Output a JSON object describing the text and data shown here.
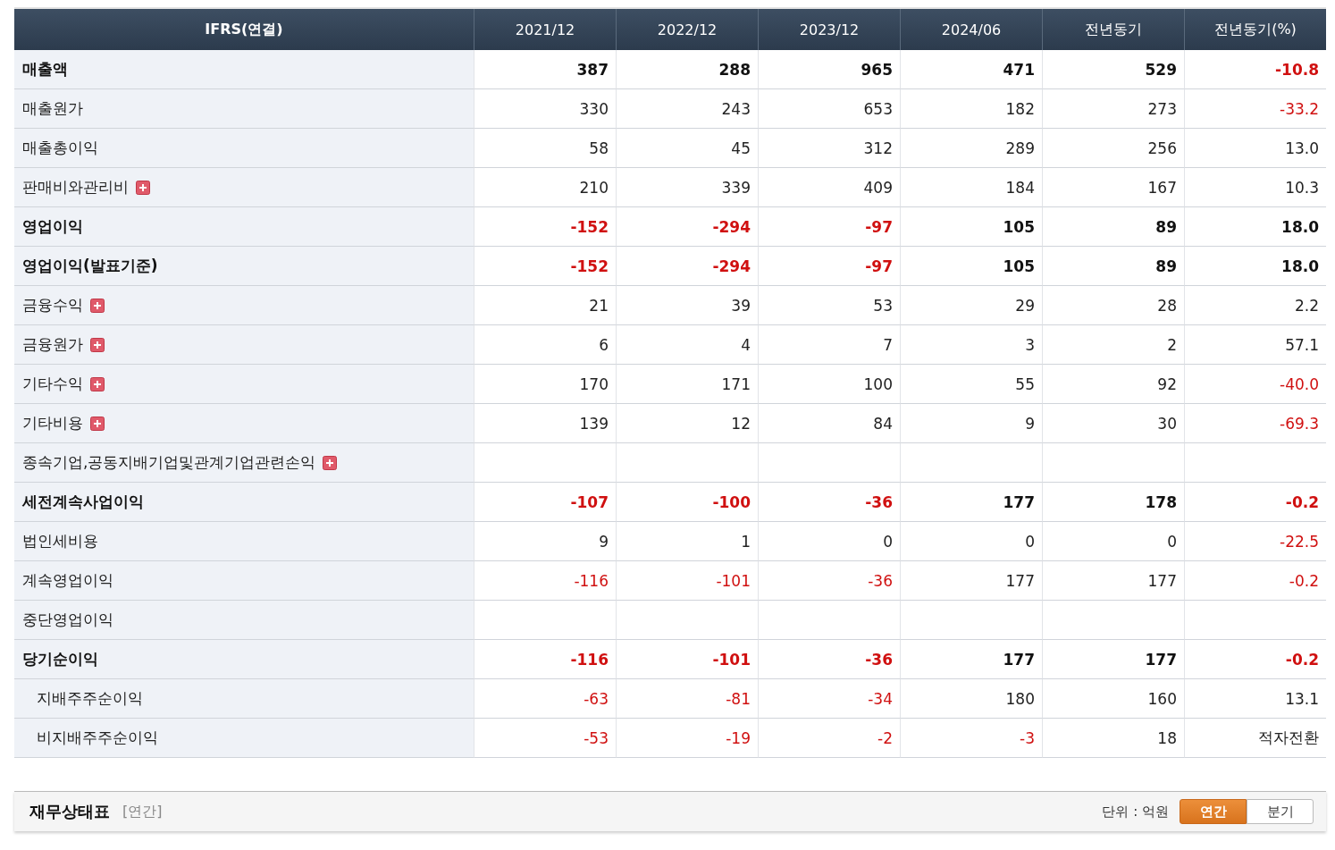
{
  "table": {
    "columns": [
      "IFRS(연결)",
      "2021/12",
      "2022/12",
      "2023/12",
      "2024/06",
      "전년동기",
      "전년동기(%)"
    ],
    "rows": [
      {
        "label": "매출액",
        "bold": true,
        "expandable": false,
        "cells": [
          {
            "value": "387",
            "negative": false
          },
          {
            "value": "288",
            "negative": false
          },
          {
            "value": "965",
            "negative": false
          },
          {
            "value": "471",
            "negative": false
          },
          {
            "value": "529",
            "negative": false
          },
          {
            "value": "-10.8",
            "negative": true
          }
        ]
      },
      {
        "label": "매출원가",
        "bold": false,
        "expandable": false,
        "cells": [
          {
            "value": "330",
            "negative": false
          },
          {
            "value": "243",
            "negative": false
          },
          {
            "value": "653",
            "negative": false
          },
          {
            "value": "182",
            "negative": false
          },
          {
            "value": "273",
            "negative": false
          },
          {
            "value": "-33.2",
            "negative": true
          }
        ]
      },
      {
        "label": "매출총이익",
        "bold": false,
        "expandable": false,
        "cells": [
          {
            "value": "58",
            "negative": false
          },
          {
            "value": "45",
            "negative": false
          },
          {
            "value": "312",
            "negative": false
          },
          {
            "value": "289",
            "negative": false
          },
          {
            "value": "256",
            "negative": false
          },
          {
            "value": "13.0",
            "negative": false
          }
        ]
      },
      {
        "label": "판매비와관리비",
        "bold": false,
        "expandable": true,
        "cells": [
          {
            "value": "210",
            "negative": false
          },
          {
            "value": "339",
            "negative": false
          },
          {
            "value": "409",
            "negative": false
          },
          {
            "value": "184",
            "negative": false
          },
          {
            "value": "167",
            "negative": false
          },
          {
            "value": "10.3",
            "negative": false
          }
        ]
      },
      {
        "label": "영업이익",
        "bold": true,
        "expandable": false,
        "cells": [
          {
            "value": "-152",
            "negative": true
          },
          {
            "value": "-294",
            "negative": true
          },
          {
            "value": "-97",
            "negative": true
          },
          {
            "value": "105",
            "negative": false
          },
          {
            "value": "89",
            "negative": false
          },
          {
            "value": "18.0",
            "negative": false
          }
        ]
      },
      {
        "label": "영업이익(발표기준)",
        "bold": true,
        "expandable": false,
        "cells": [
          {
            "value": "-152",
            "negative": true
          },
          {
            "value": "-294",
            "negative": true
          },
          {
            "value": "-97",
            "negative": true
          },
          {
            "value": "105",
            "negative": false
          },
          {
            "value": "89",
            "negative": false
          },
          {
            "value": "18.0",
            "negative": false
          }
        ]
      },
      {
        "label": "금융수익",
        "bold": false,
        "expandable": true,
        "cells": [
          {
            "value": "21",
            "negative": false
          },
          {
            "value": "39",
            "negative": false
          },
          {
            "value": "53",
            "negative": false
          },
          {
            "value": "29",
            "negative": false
          },
          {
            "value": "28",
            "negative": false
          },
          {
            "value": "2.2",
            "negative": false
          }
        ]
      },
      {
        "label": "금융원가",
        "bold": false,
        "expandable": true,
        "cells": [
          {
            "value": "6",
            "negative": false
          },
          {
            "value": "4",
            "negative": false
          },
          {
            "value": "7",
            "negative": false
          },
          {
            "value": "3",
            "negative": false
          },
          {
            "value": "2",
            "negative": false
          },
          {
            "value": "57.1",
            "negative": false
          }
        ]
      },
      {
        "label": "기타수익",
        "bold": false,
        "expandable": true,
        "cells": [
          {
            "value": "170",
            "negative": false
          },
          {
            "value": "171",
            "negative": false
          },
          {
            "value": "100",
            "negative": false
          },
          {
            "value": "55",
            "negative": false
          },
          {
            "value": "92",
            "negative": false
          },
          {
            "value": "-40.0",
            "negative": true
          }
        ]
      },
      {
        "label": "기타비용",
        "bold": false,
        "expandable": true,
        "cells": [
          {
            "value": "139",
            "negative": false
          },
          {
            "value": "12",
            "negative": false
          },
          {
            "value": "84",
            "negative": false
          },
          {
            "value": "9",
            "negative": false
          },
          {
            "value": "30",
            "negative": false
          },
          {
            "value": "-69.3",
            "negative": true
          }
        ]
      },
      {
        "label": "종속기업,공동지배기업및관계기업관련손익",
        "bold": false,
        "expandable": true,
        "cells": []
      },
      {
        "label": "세전계속사업이익",
        "bold": true,
        "expandable": false,
        "cells": [
          {
            "value": "-107",
            "negative": true
          },
          {
            "value": "-100",
            "negative": true
          },
          {
            "value": "-36",
            "negative": true
          },
          {
            "value": "177",
            "negative": false
          },
          {
            "value": "178",
            "negative": false
          },
          {
            "value": "-0.2",
            "negative": true
          }
        ]
      },
      {
        "label": "법인세비용",
        "bold": false,
        "expandable": false,
        "cells": [
          {
            "value": "9",
            "negative": false
          },
          {
            "value": "1",
            "negative": false
          },
          {
            "value": "0",
            "negative": false
          },
          {
            "value": "0",
            "negative": false
          },
          {
            "value": "0",
            "negative": false
          },
          {
            "value": "-22.5",
            "negative": true
          }
        ]
      },
      {
        "label": "계속영업이익",
        "bold": false,
        "expandable": false,
        "cells": [
          {
            "value": "-116",
            "negative": true
          },
          {
            "value": "-101",
            "negative": true
          },
          {
            "value": "-36",
            "negative": true
          },
          {
            "value": "177",
            "negative": false
          },
          {
            "value": "177",
            "negative": false
          },
          {
            "value": "-0.2",
            "negative": true
          }
        ]
      },
      {
        "label": "중단영업이익",
        "bold": false,
        "expandable": false,
        "cells": []
      },
      {
        "label": "당기순이익",
        "bold": true,
        "expandable": false,
        "cells": [
          {
            "value": "-116",
            "negative": true
          },
          {
            "value": "-101",
            "negative": true
          },
          {
            "value": "-36",
            "negative": true
          },
          {
            "value": "177",
            "negative": false
          },
          {
            "value": "177",
            "negative": false
          },
          {
            "value": "-0.2",
            "negative": true
          }
        ],
        "children": [
          {
            "label": "지배주주순이익",
            "bold": false,
            "expandable": false,
            "cells": [
              {
                "value": "-63",
                "negative": true
              },
              {
                "value": "-81",
                "negative": true
              },
              {
                "value": "-34",
                "negative": true
              },
              {
                "value": "180",
                "negative": false
              },
              {
                "value": "160",
                "negative": false
              },
              {
                "value": "13.1",
                "negative": false
              }
            ]
          },
          {
            "label": "비지배주주순이익",
            "bold": false,
            "expandable": false,
            "cells": [
              {
                "value": "-53",
                "negative": true
              },
              {
                "value": "-19",
                "negative": true
              },
              {
                "value": "-2",
                "negative": true
              },
              {
                "value": "-3",
                "negative": true
              },
              {
                "value": "18",
                "negative": false
              },
              {
                "value": "적자전환",
                "negative": false
              }
            ]
          }
        ]
      }
    ]
  },
  "section": {
    "title": "재무상태표",
    "period": "[연간]",
    "unit": "단위 : 억원",
    "toggles": [
      {
        "label": "연간",
        "selected": true
      },
      {
        "label": "분기",
        "selected": false
      }
    ]
  }
}
